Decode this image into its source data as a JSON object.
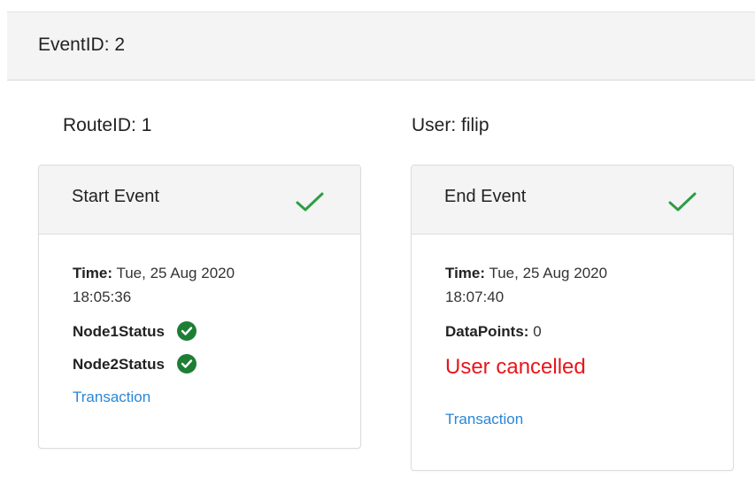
{
  "event": {
    "id_label": "EventID: 2"
  },
  "route_label": "RouteID: 1",
  "user_label": "User: filip",
  "start_card": {
    "title": "Start Event",
    "time_label": "Time:",
    "time_value_line1": " Tue, 25 Aug 2020",
    "time_value_line2": "18:05:36",
    "node1_label": "Node1Status",
    "node2_label": "Node2Status",
    "link": "Transaction",
    "check_icon": "check-icon",
    "status_icon": "check-circle-icon",
    "success_color": "#1e7e34"
  },
  "end_card": {
    "title": "End Event",
    "time_label": "Time:",
    "time_value_line1": " Tue, 25 Aug 2020",
    "time_value_line2": "18:07:40",
    "datapoints_label": "DataPoints:",
    "datapoints_value": " 0",
    "cancel_text": "User cancelled",
    "link": "Transaction",
    "check_icon": "check-icon",
    "cancel_color": "#e8161b"
  },
  "colors": {
    "accent_link": "#2a86d6",
    "check_green": "#2e9e44"
  }
}
